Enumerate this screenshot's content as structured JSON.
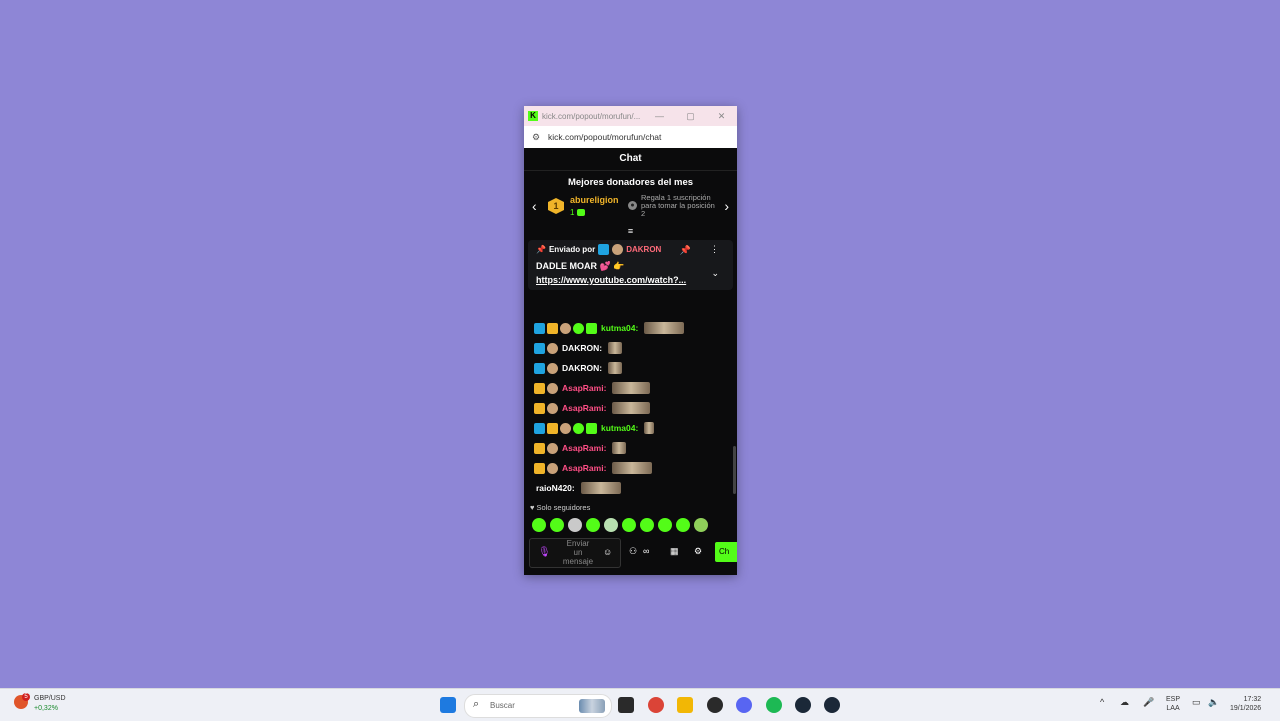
{
  "popup": {
    "tab_title": "kick.com/popout/morufun/...",
    "url": "kick.com/popout/morufun/chat",
    "header": "Chat",
    "donors_title": "Mejores donadores del mes",
    "top_donor": {
      "rank": "1",
      "name": "abureligion",
      "count": "1"
    },
    "gift_text": "Regala 1 suscripción para tomar la posición 2",
    "pinned": {
      "prefix": "Enviado por",
      "sender": "DAKRON",
      "message": "DADLE MOAR 💕 👉",
      "link": "https://www.youtube.com/watch?..."
    },
    "messages": [
      {
        "user": "kutma04:",
        "color": "#53fc18",
        "badges": [
          "mod",
          "vip",
          "og",
          "sub",
          "bot"
        ],
        "emote": "wide"
      },
      {
        "user": "DAKRON:",
        "color": "#ffffff",
        "badges": [
          "mod",
          "og"
        ],
        "emote": "small"
      },
      {
        "user": "DAKRON:",
        "color": "#ffffff",
        "badges": [
          "mod",
          "og"
        ],
        "emote": "small"
      },
      {
        "user": "AsapRami:",
        "color": "#ff4f86",
        "badges": [
          "vip",
          "og"
        ],
        "emote": "medium"
      },
      {
        "user": "AsapRami:",
        "color": "#ff4f86",
        "badges": [
          "vip",
          "og"
        ],
        "emote": "medium"
      },
      {
        "user": "kutma04:",
        "color": "#53fc18",
        "badges": [
          "mod",
          "vip",
          "og",
          "sub",
          "bot"
        ],
        "emote": "tiny"
      },
      {
        "user": "AsapRami:",
        "color": "#ff4f86",
        "badges": [
          "vip",
          "og"
        ],
        "emote": "small"
      },
      {
        "user": "AsapRami:",
        "color": "#ff4f86",
        "badges": [
          "vip",
          "og"
        ],
        "emote": "wide"
      },
      {
        "user": "raioN420:",
        "color": "#ffffff",
        "badges": [],
        "emote": "wide"
      }
    ],
    "followers_only": "Solo seguidores",
    "input_placeholder": "Enviar un mensaje",
    "send_label": "Ch"
  },
  "taskbar": {
    "widget_title": "GBP/USD",
    "widget_value": "+0,32%",
    "widget_badge": "5",
    "search_placeholder": "Buscar",
    "lang_line1": "ESP",
    "lang_line2": "LAA",
    "time": "17:32",
    "date": "19/1/2026"
  }
}
